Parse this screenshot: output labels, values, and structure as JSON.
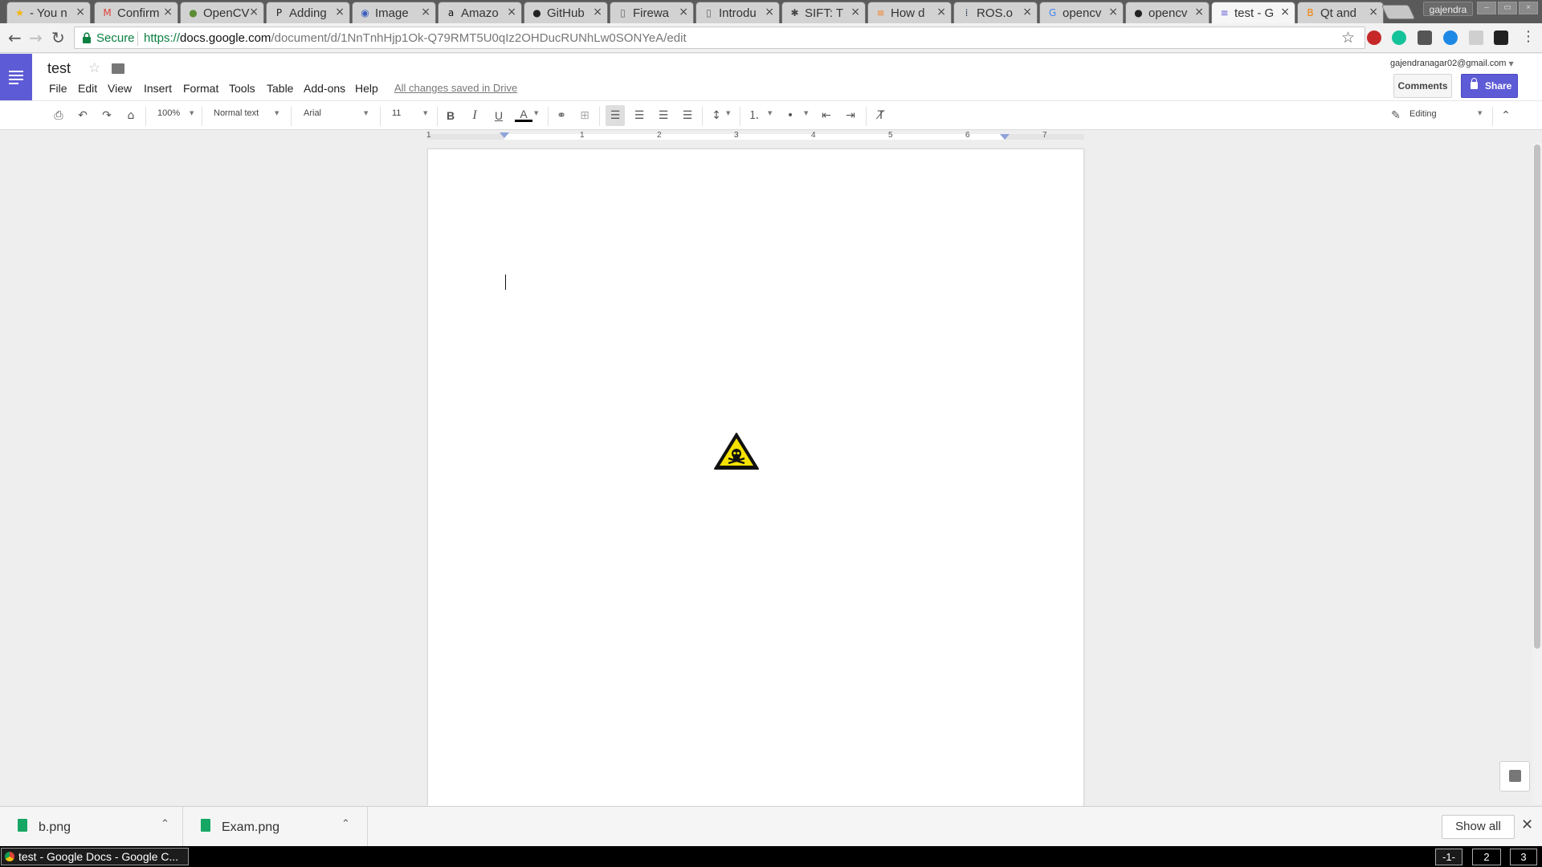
{
  "browser": {
    "tabs": [
      {
        "title": " - You n",
        "favicon": "★",
        "favicon_color": "#f4b400"
      },
      {
        "title": "Confirm",
        "favicon": "M",
        "favicon_color": "#db4437"
      },
      {
        "title": "OpenCV",
        "favicon": "●",
        "favicon_color": "#5c8d34"
      },
      {
        "title": "Adding",
        "favicon": "P",
        "favicon_color": "#222222"
      },
      {
        "title": "Image",
        "favicon": "◉",
        "favicon_color": "#3b5fc0"
      },
      {
        "title": "Amazo",
        "favicon": "a",
        "favicon_color": "#111111"
      },
      {
        "title": "GitHub",
        "favicon": "●",
        "favicon_color": "#222222"
      },
      {
        "title": "Firewa",
        "favicon": "▯",
        "favicon_color": "#666666"
      },
      {
        "title": "Introdu",
        "favicon": "▯",
        "favicon_color": "#666666"
      },
      {
        "title": "SIFT: T",
        "favicon": "✱",
        "favicon_color": "#444444"
      },
      {
        "title": "How d",
        "favicon": "≡",
        "favicon_color": "#f48024"
      },
      {
        "title": "ROS.o",
        "favicon": "⁞",
        "favicon_color": "#22314e"
      },
      {
        "title": "opencv",
        "favicon": "G",
        "favicon_color": "#4285f4"
      },
      {
        "title": "opencv",
        "favicon": "●",
        "favicon_color": "#222222"
      },
      {
        "title": "test - G",
        "favicon": "≡",
        "favicon_color": "#5e5bd6"
      },
      {
        "title": "Qt and",
        "favicon": "B",
        "favicon_color": "#f57d00"
      }
    ],
    "close_glyph": "×",
    "profile_name": "gajendra",
    "secure_label": "Secure",
    "url_scheme": "https://",
    "url_host": "docs.google.com",
    "url_path": "/document/d/1NnTnhHjp1Ok-Q79RMT5U0qIz2OHDucRUNhLw0SONYeA/edit",
    "accent": "#5e5bd6"
  },
  "docs": {
    "title": "test",
    "menu": [
      "File",
      "Edit",
      "View",
      "Insert",
      "Format",
      "Tools",
      "Table",
      "Add-ons",
      "Help"
    ],
    "save_status": "All changes saved in Drive",
    "account": "gajendranagar02@gmail.com",
    "comments_label": "Comments",
    "share_label": "Share"
  },
  "toolbar": {
    "zoom": "100%",
    "style": "Normal text",
    "font": "Arial",
    "size": "11",
    "mode": "Editing"
  },
  "ruler": {
    "numbers": [
      "1",
      "1",
      "2",
      "3",
      "4",
      "5",
      "6",
      "7"
    ]
  },
  "page": {
    "image_icon": "hazard-skull-icon"
  },
  "downloads": {
    "items": [
      {
        "name": "b.png"
      },
      {
        "name": "Exam.png"
      }
    ],
    "show_all": "Show all"
  },
  "taskbar": {
    "window_title": "test - Google Docs - Google C...",
    "workspaces": [
      "-1-",
      "2",
      "3"
    ]
  }
}
